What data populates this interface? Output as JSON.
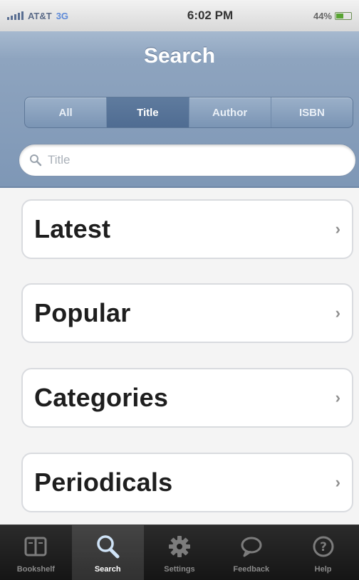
{
  "status_bar": {
    "carrier": "AT&T",
    "network": "3G",
    "time": "6:02 PM",
    "battery": "44%"
  },
  "nav": {
    "title": "Search"
  },
  "segments": [
    {
      "label": "All",
      "active": false
    },
    {
      "label": "Title",
      "active": true
    },
    {
      "label": "Author",
      "active": false
    },
    {
      "label": "ISBN",
      "active": false
    }
  ],
  "search": {
    "placeholder": "Title",
    "value": ""
  },
  "menu": [
    {
      "label": "Latest"
    },
    {
      "label": "Popular"
    },
    {
      "label": "Categories"
    },
    {
      "label": "Periodicals"
    }
  ],
  "tabs": [
    {
      "label": "Bookshelf",
      "icon": "bookshelf-icon",
      "active": false
    },
    {
      "label": "Search",
      "icon": "search-icon",
      "active": true
    },
    {
      "label": "Settings",
      "icon": "gear-icon",
      "active": false
    },
    {
      "label": "Feedback",
      "icon": "speech-bubble-icon",
      "active": false
    },
    {
      "label": "Help",
      "icon": "help-icon",
      "active": false
    }
  ],
  "colors": {
    "nav_bar": "#8ea4bf",
    "segment_active": "#4f6c92",
    "tab_bar": "#1e1e1e"
  }
}
